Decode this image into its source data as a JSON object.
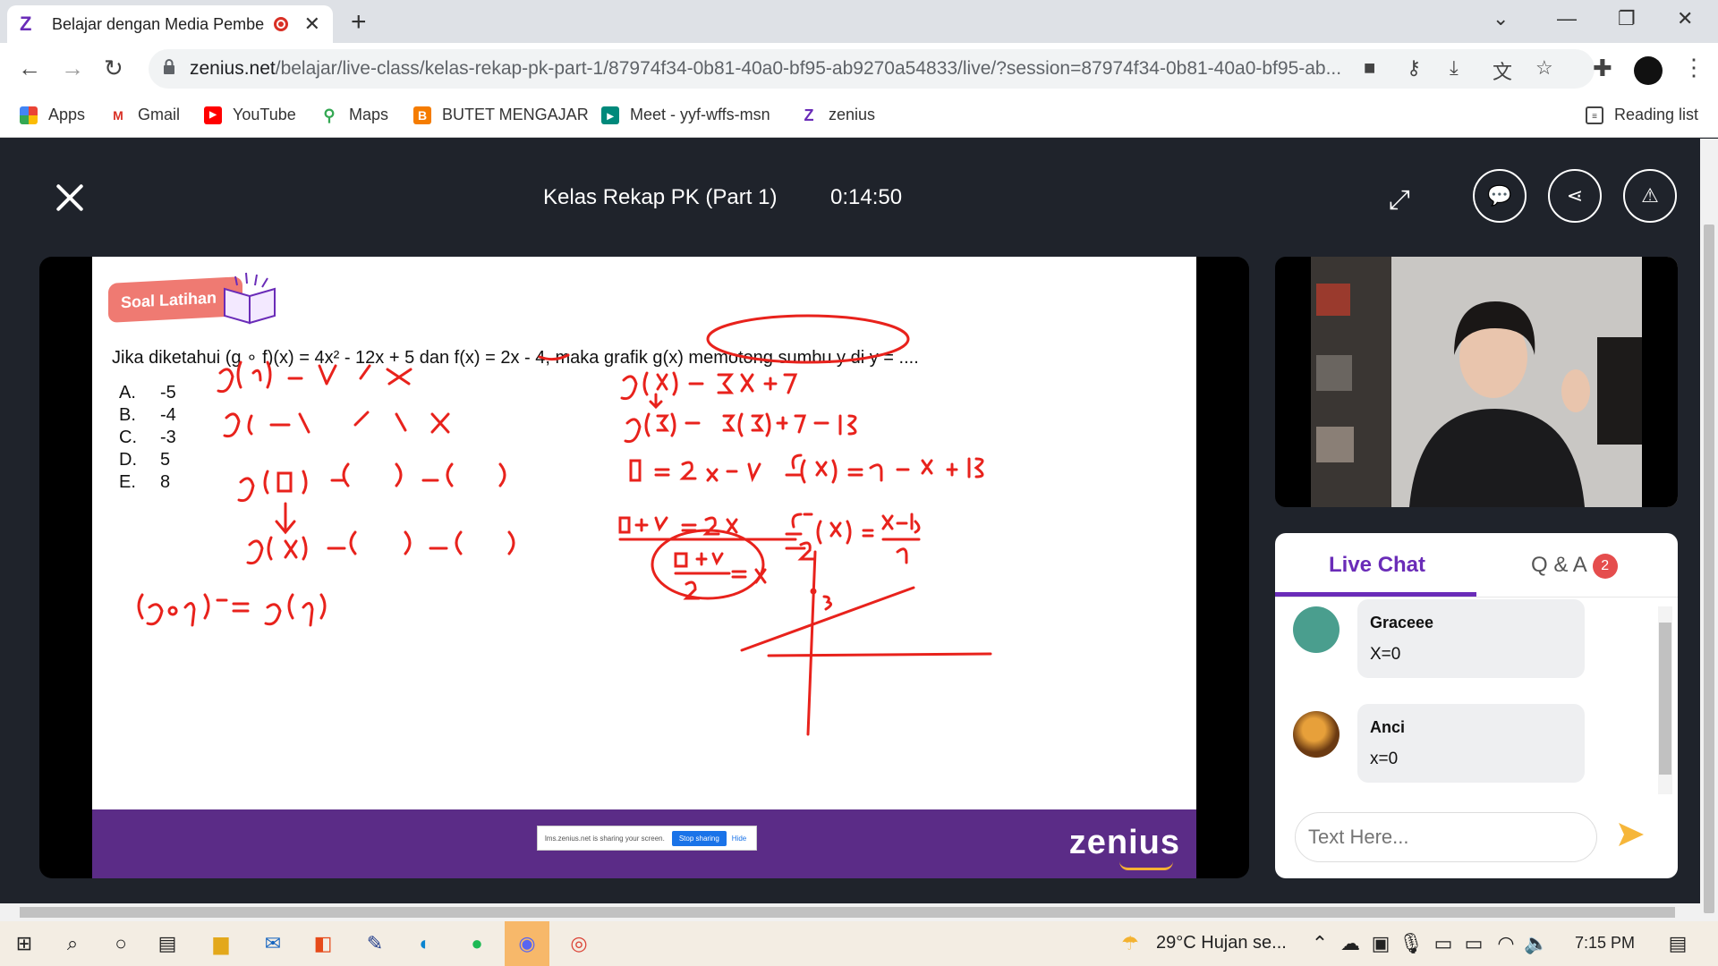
{
  "browser": {
    "tab_title": "Belajar dengan Media Pembe",
    "url_domain": "zenius.net",
    "url_path": "/belajar/live-class/kelas-rekap-pk-part-1/87974f34-0b81-40a0-bf95-ab9270a54833/live/?session=87974f34-0b81-40a0-bf95-ab...",
    "bookmarks": [
      "Apps",
      "Gmail",
      "YouTube",
      "Maps",
      "BUTET MENGAJAR",
      "Meet - yyf-wffs-msn",
      "zenius"
    ],
    "reading_list": "Reading list"
  },
  "header": {
    "title": "Kelas Rekap PK (Part 1)",
    "timer": "0:14:50"
  },
  "slide": {
    "badge": "Soal Latihan",
    "question": "Jika diketahui (g ∘ f)(x) = 4x² - 12x + 5 dan f(x) = 2x - 4, maka grafik g(x) memotong sumbu y di y = ....",
    "options": [
      {
        "letter": "A.",
        "value": "-5"
      },
      {
        "letter": "B.",
        "value": "-4"
      },
      {
        "letter": "C.",
        "value": "-3"
      },
      {
        "letter": "D.",
        "value": "5"
      },
      {
        "letter": "E.",
        "value": "8"
      }
    ],
    "share_text": "lms.zenius.net is sharing your screen.",
    "share_stop": "Stop sharing",
    "share_hide": "Hide",
    "brand": "zenius"
  },
  "chat": {
    "tab_live": "Live Chat",
    "tab_qa": "Q & A",
    "qa_count": "2",
    "messages": [
      {
        "author": "Graceee",
        "text": "X=0"
      },
      {
        "author": "Anci",
        "text": "x=0"
      }
    ],
    "placeholder": "Text Here..."
  },
  "taskbar": {
    "weather": "29°C  Hujan se...",
    "time": "7:15 PM"
  },
  "colors": {
    "accent": "#6a2cb8",
    "ink": "#e8221c",
    "footer": "#5b2c87"
  }
}
